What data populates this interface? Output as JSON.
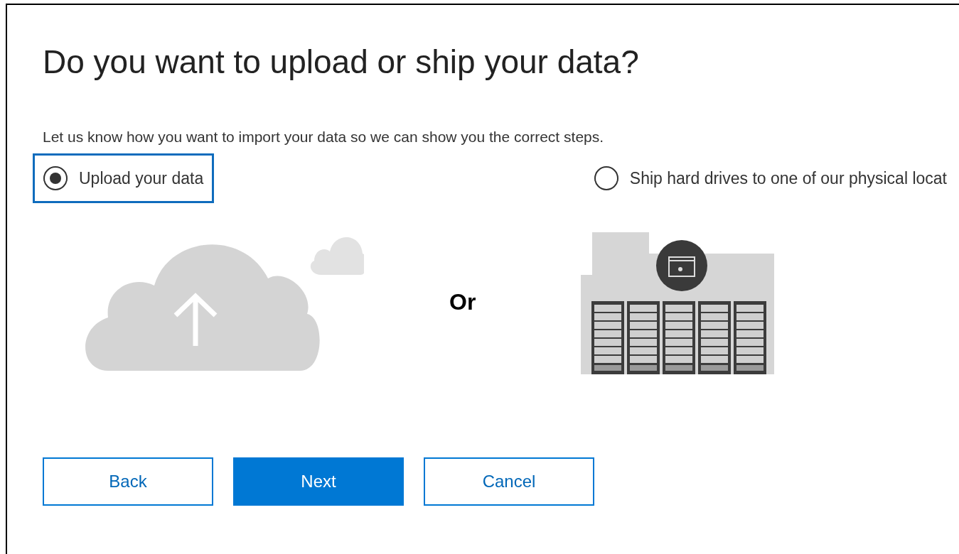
{
  "title": "Do you want to upload or ship your data?",
  "description": "Let us know how you want to import your data so we can show you the correct steps.",
  "options": [
    {
      "label": "Upload your data",
      "selected": true,
      "focused": true
    },
    {
      "label": "Ship hard drives to one of our physical locat",
      "selected": false,
      "focused": false
    }
  ],
  "separator": "Or",
  "buttons": [
    {
      "label": "Back",
      "kind": "secondary"
    },
    {
      "label": "Next",
      "kind": "primary"
    },
    {
      "label": "Cancel",
      "kind": "secondary"
    }
  ]
}
